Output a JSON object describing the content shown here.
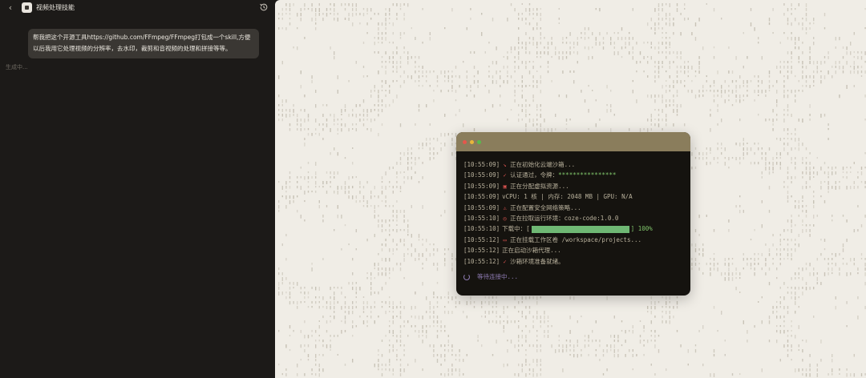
{
  "header": {
    "title": "视频处理技能"
  },
  "chat": {
    "user_message": "帮我把这个开源工具https://github.com/FFmpeg/FFmpeg打包成一个skill,方便以后我用它处理视频的分辨率，去水印，裁剪和音视频的处理和拼接等等。",
    "status": "生成中..."
  },
  "terminal": {
    "lines": [
      {
        "time": "[10:55:09]",
        "icon": "rocket-icon",
        "text": "正在初始化云端沙箱..."
      },
      {
        "time": "[10:55:09]",
        "icon": "check-circle-icon",
        "text": "认证通过，令牌：",
        "highlight": "****************"
      },
      {
        "time": "[10:55:09]",
        "icon": "chip-icon",
        "text": "正在分配虚拟资源..."
      },
      {
        "time": "[10:55:09]",
        "icon": "",
        "text": "vCPU: 1 核 | 内存: 2048 MB | GPU: N/A"
      },
      {
        "time": "[10:55:09]",
        "icon": "network-icon",
        "text": "正在配置安全网络策略..."
      },
      {
        "time": "[10:55:10]",
        "icon": "globe-icon",
        "text": "正在拉取运行环境：coze-code:1.0.0"
      },
      {
        "time": "[10:55:10]",
        "icon": "",
        "text": "下载中：[",
        "progress": 1.0,
        "suffix": "] 100%"
      },
      {
        "time": "[10:55:12]",
        "icon": "folder-icon",
        "text": "正在挂载工作区卷 /workspace/projects..."
      },
      {
        "time": "[10:55:12]",
        "icon": "",
        "text": "正在启动沙箱代理..."
      },
      {
        "time": "[10:55:12]",
        "icon": "check-circle-icon",
        "text": "沙箱环境准备就绪。"
      }
    ],
    "waiting": "等待连接中..."
  }
}
